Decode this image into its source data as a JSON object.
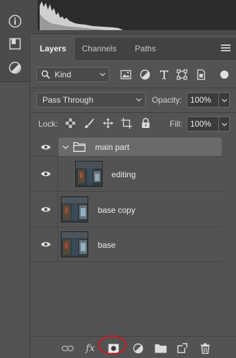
{
  "panel": {
    "tabs": [
      {
        "label": "Layers",
        "active": true
      },
      {
        "label": "Channels",
        "active": false
      },
      {
        "label": "Paths",
        "active": false
      }
    ]
  },
  "filter": {
    "kind_label": "Kind",
    "icons": [
      "pixel-filter-icon",
      "adjustment-filter-icon",
      "type-filter-icon",
      "shape-filter-icon",
      "smart-object-filter-icon"
    ]
  },
  "blend": {
    "mode": "Pass Through",
    "opacity_label": "Opacity:",
    "opacity_value": "100%"
  },
  "lock": {
    "label": "Lock:",
    "fill_label": "Fill:",
    "fill_value": "100%"
  },
  "layers": [
    {
      "name": "main part",
      "type": "group",
      "expanded": true,
      "visible": true
    },
    {
      "name": "editing",
      "type": "pixel",
      "indent": true,
      "visible": true
    },
    {
      "name": "base copy",
      "type": "pixel",
      "indent": false,
      "visible": true
    },
    {
      "name": "base",
      "type": "pixel",
      "indent": false,
      "visible": true
    }
  ],
  "bottom_toolbar": [
    "link-layers-icon",
    "fx-icon",
    "add-mask-icon",
    "adjustment-layer-icon",
    "new-group-icon",
    "new-layer-icon",
    "delete-layer-icon"
  ],
  "bottom_fx_label": "fx",
  "annotation": {
    "color": "#d0161c",
    "target": "add-mask-icon"
  },
  "colors": {
    "panel_bg": "#535353",
    "group_row": "#6a6a6a",
    "accent_circle": "#d0161c"
  }
}
